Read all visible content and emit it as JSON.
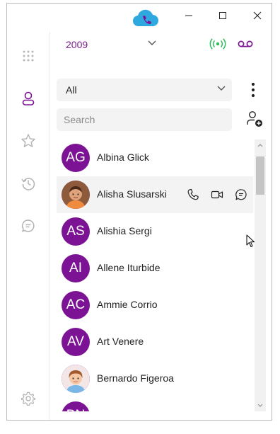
{
  "window": {
    "controls": [
      "minimize",
      "maximize",
      "close"
    ]
  },
  "header": {
    "extension": "2009"
  },
  "colors": {
    "accent": "#7b1394",
    "status_ok": "#2ebd59",
    "brand_blue": "#2fa8e0"
  },
  "rail": {
    "icons": [
      "dialpad-icon",
      "contacts-icon",
      "favorites-icon",
      "history-icon",
      "chat-icon",
      "settings-icon"
    ],
    "active": "contacts-icon"
  },
  "filter": {
    "selected": "All"
  },
  "search": {
    "placeholder": "Search"
  },
  "contacts": [
    {
      "initials": "AG",
      "name": "Albina Glick",
      "photo": false
    },
    {
      "initials": "",
      "name": "Alisha Slusarski",
      "photo": true
    },
    {
      "initials": "AS",
      "name": "Alishia Sergi",
      "photo": false
    },
    {
      "initials": "AI",
      "name": "Allene Iturbide",
      "photo": false
    },
    {
      "initials": "AC",
      "name": "Ammie Corrio",
      "photo": false
    },
    {
      "initials": "AV",
      "name": "Art Venere",
      "photo": false
    },
    {
      "initials": "",
      "name": "Bernardo Figeroa",
      "photo": true
    },
    {
      "initials": "BN",
      "name": "",
      "photo": false
    }
  ],
  "hovered_contact": "Alisha Slusarski"
}
